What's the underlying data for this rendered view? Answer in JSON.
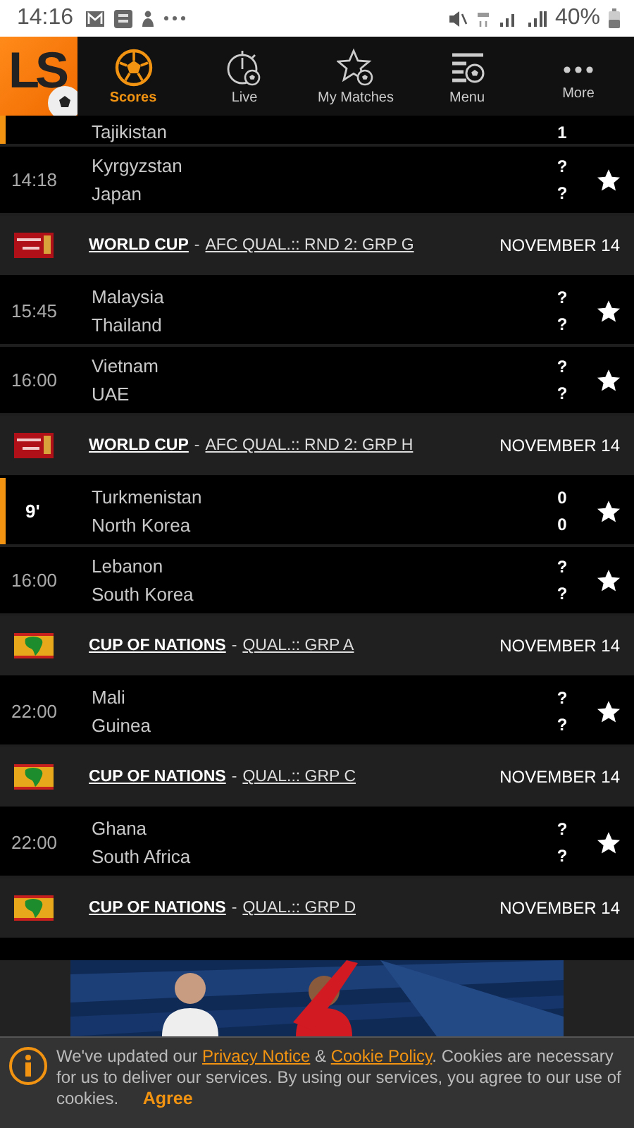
{
  "status_bar": {
    "time": "14:16",
    "battery": "40%"
  },
  "nav": {
    "logo": "LS",
    "tabs": [
      {
        "label": "Scores",
        "selected": true
      },
      {
        "label": "Live",
        "selected": false
      },
      {
        "label": "My Matches",
        "selected": false
      },
      {
        "label": "Menu",
        "selected": false
      },
      {
        "label": "More",
        "selected": false
      }
    ]
  },
  "list": [
    {
      "kind": "match_cut",
      "away": "Tajikistan",
      "away_score": "1",
      "live": true
    },
    {
      "kind": "match",
      "time": "14:18",
      "home": "Kyrgyzstan",
      "away": "Japan",
      "home_score": "?",
      "away_score": "?",
      "live": false
    },
    {
      "kind": "wcheader",
      "competition": "WORLD CUP",
      "separator": "-",
      "stage": "AFC QUAL.:: RND 2: GRP G",
      "date": "NOVEMBER 14"
    },
    {
      "kind": "match",
      "time": "15:45",
      "home": "Malaysia",
      "away": "Thailand",
      "home_score": "?",
      "away_score": "?",
      "live": false
    },
    {
      "kind": "match",
      "time": "16:00",
      "home": "Vietnam",
      "away": "UAE",
      "home_score": "?",
      "away_score": "?",
      "live": false
    },
    {
      "kind": "wcheader",
      "competition": "WORLD CUP",
      "separator": "-",
      "stage": "AFC QUAL.:: RND 2: GRP H",
      "date": "NOVEMBER 14"
    },
    {
      "kind": "match",
      "time": "9'",
      "home": "Turkmenistan",
      "away": "North Korea",
      "home_score": "0",
      "away_score": "0",
      "live": true
    },
    {
      "kind": "match",
      "time": "16:00",
      "home": "Lebanon",
      "away": "South Korea",
      "home_score": "?",
      "away_score": "?",
      "live": false
    },
    {
      "kind": "afconheader",
      "competition": "CUP OF NATIONS",
      "separator": "-",
      "stage": "QUAL.:: GRP A",
      "date": "NOVEMBER 14"
    },
    {
      "kind": "match",
      "time": "22:00",
      "home": "Mali",
      "away": "Guinea",
      "home_score": "?",
      "away_score": "?",
      "live": false
    },
    {
      "kind": "afconheader",
      "competition": "CUP OF NATIONS",
      "separator": "-",
      "stage": "QUAL.:: GRP C",
      "date": "NOVEMBER 14"
    },
    {
      "kind": "match",
      "time": "22:00",
      "home": "Ghana",
      "away": "South Africa",
      "home_score": "?",
      "away_score": "?",
      "live": false
    },
    {
      "kind": "afconheader",
      "competition": "CUP OF NATIONS",
      "separator": "-",
      "stage": "QUAL.:: GRP D",
      "date": "NOVEMBER 14"
    },
    {
      "kind": "cut"
    }
  ],
  "cookie_banner": {
    "text_before": "We've updated our ",
    "privacy_link": "Privacy Notice",
    "between": " & ",
    "cookie_link": "Cookie Policy",
    "text_after": ". Cookies are necessary for us to deliver our services. By using our services, you agree to our use of cookies.",
    "button": "Agree"
  }
}
